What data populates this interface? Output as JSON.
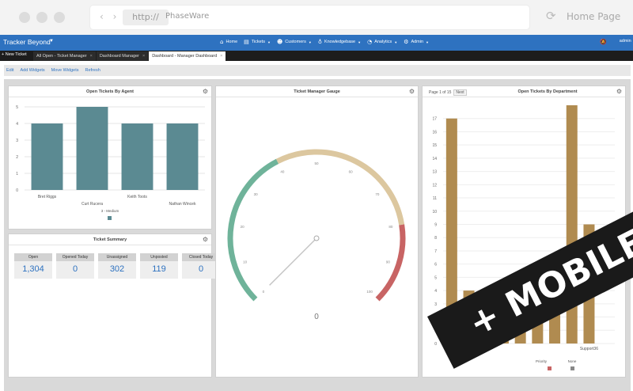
{
  "browser": {
    "url_prefix": "http://",
    "url": "PhaseWare",
    "home_label": "Home Page",
    "nav_arrows": "‹ ›",
    "reload_icon": "refresh-icon"
  },
  "app": {
    "brand": "Tracker Beyond",
    "nav": [
      {
        "label": "Home",
        "icon": "home-icon"
      },
      {
        "label": "Tickets",
        "icon": "tickets-icon"
      },
      {
        "label": "Customers",
        "icon": "users-icon"
      },
      {
        "label": "Knowledgebase",
        "icon": "lightbulb-icon"
      },
      {
        "label": "Analytics",
        "icon": "pie-chart-icon"
      },
      {
        "label": "Admin",
        "icon": "gear-icon"
      }
    ],
    "user": "admin"
  },
  "tabs": {
    "new_ticket": "+ New Ticket",
    "items": [
      {
        "label": "All Open - Ticket Manager"
      },
      {
        "label": "Dashboard Manager"
      },
      {
        "label": "Dashboard - Manager Dashboard"
      }
    ]
  },
  "toolbar": {
    "edit": "Edit",
    "add_widgets": "Add Widgets",
    "move_widgets": "Move Widgets",
    "refresh": "Refresh"
  },
  "panels": {
    "agent": {
      "title": "Open Tickets By Agent",
      "legend": "3 - Medium"
    },
    "summary": {
      "title": "Ticket Summary",
      "boxes": [
        {
          "label": "Open",
          "value": "1,304"
        },
        {
          "label": "Opened Today",
          "value": "0"
        },
        {
          "label": "Unassigned",
          "value": "302"
        },
        {
          "label": "Unposted",
          "value": "119"
        },
        {
          "label": "Closed Today",
          "value": "0"
        }
      ]
    },
    "gauge": {
      "title": "Ticket Manager Gauge",
      "value": "0"
    },
    "department": {
      "title": "Open Tickets By Department",
      "page": "Page 1 of 15",
      "next": "Next",
      "legend_a": "Priority",
      "legend_b": "None"
    }
  },
  "colors": {
    "agent_bar": "#5b8a92",
    "dept_bar": "#b08b50",
    "gauge_green": "#6fb39a",
    "gauge_tan": "#dcc79f",
    "gauge_red": "#c86464",
    "brand": "#2e72c0"
  },
  "chart_data": [
    {
      "type": "bar",
      "title": "Open Tickets By Agent",
      "categories": [
        "Bret Riggs",
        "Curt Rucera",
        "Keith Toots",
        "Nathan Wincek"
      ],
      "series": [
        {
          "name": "3 - Medium",
          "values": [
            4,
            5,
            4,
            4
          ]
        }
      ],
      "ylim": [
        0,
        5
      ],
      "yticks": [
        0,
        1,
        2,
        3,
        4,
        5
      ],
      "grid": true
    },
    {
      "type": "gauge",
      "title": "Ticket Manager Gauge",
      "range": [
        0,
        100
      ],
      "ticks": [
        0,
        10,
        20,
        30,
        40,
        50,
        60,
        70,
        80,
        90,
        100
      ],
      "bands": [
        {
          "from": 0,
          "to": 40,
          "color": "#6fb39a"
        },
        {
          "from": 40,
          "to": 80,
          "color": "#dcc79f"
        },
        {
          "from": 80,
          "to": 100,
          "color": "#c86464"
        }
      ],
      "value": 0
    },
    {
      "type": "bar",
      "title": "Open Tickets By Department",
      "categories": [
        "AdH",
        "",
        "",
        "",
        "",
        "",
        "",
        "",
        "Support36",
        ""
      ],
      "values": [
        17,
        4,
        4,
        4,
        5,
        4,
        4,
        18,
        9
      ],
      "ylim": [
        0,
        18
      ],
      "yticks": [
        0,
        1,
        2,
        3,
        4,
        5,
        6,
        7,
        8,
        9,
        10,
        11,
        12,
        13,
        14,
        15,
        16,
        17
      ],
      "grid": true
    }
  ],
  "banner": "+ MOBILE"
}
